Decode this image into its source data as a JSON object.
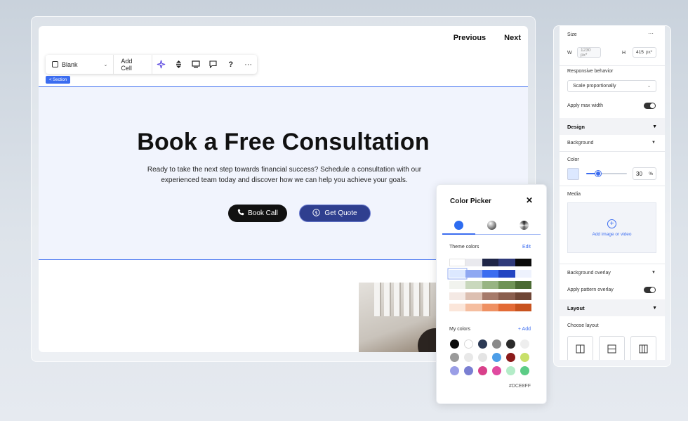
{
  "nav": {
    "previous": "Previous",
    "next": "Next"
  },
  "toolbar": {
    "blank_label": "Blank",
    "add_cell_label": "Add Cell"
  },
  "section_tag": "< Section",
  "hero": {
    "title": "Book a Free Consultation",
    "subtitle": "Ready to take the next step towards financial success? Schedule a consultation with our experienced team today and discover how we can help you achieve your goals.",
    "book_call": "Book Call",
    "get_quote": "Get Quote"
  },
  "color_picker": {
    "title": "Color Picker",
    "close": "✕",
    "theme_label": "Theme colors",
    "edit_label": "Edit",
    "my_colors_label": "My colors",
    "add_label": "+ Add",
    "hex_value": "#DCE8FF",
    "theme_rows": [
      [
        "#ffffff",
        "#e9e9ee",
        "#1e2547",
        "#2f3a7a",
        "#0a0a0a"
      ],
      [
        "#dce8ff",
        "#8fa8f2",
        "#3b6cf0",
        "#2244c2",
        "#eef2fd"
      ],
      [
        "#f1f3ee",
        "#c9d8bd",
        "#98b483",
        "#6f9356",
        "#4a6a33"
      ],
      [
        "#f4e9e4",
        "#dcbfb1",
        "#a67a6a",
        "#8a5e4e",
        "#6e4535"
      ],
      [
        "#fbe6da",
        "#f5bea0",
        "#ef9163",
        "#e36b36",
        "#c8531f"
      ]
    ],
    "my_colors": [
      "#0a0a0a",
      "#ffffff",
      "#2c3a55",
      "#8a8a8a",
      "#2b2b2b",
      "#eeeeee",
      "#9a9a9a",
      "#e8e8e8",
      "#e4e4e4",
      "#4d9ee8",
      "#8b1a1a",
      "#c8e06a",
      "#9a9ee6",
      "#7a7fd2",
      "#d8408a",
      "#e04aa0",
      "#b4ecc8",
      "#5ccc86"
    ]
  },
  "inspector": {
    "size_label": "Size",
    "w_label": "W",
    "w_value": "1230 px*",
    "h_label": "H",
    "h_value": "415",
    "h_unit": "px*",
    "more": "···",
    "responsive_label": "Responsive behavior",
    "responsive_value": "Scale proportionally",
    "max_width_label": "Apply max width",
    "design_label": "Design",
    "background_label": "Background",
    "color_label": "Color",
    "color_swatch": "#dce8ff",
    "opacity_value": "30",
    "opacity_fraction": 0.3,
    "opacity_unit": "%",
    "media_label": "Media",
    "media_add": "Add image or video",
    "bg_overlay_label": "Background overlay",
    "pattern_label": "Apply pattern overlay",
    "layout_label": "Layout",
    "choose_layout_label": "Choose layout"
  },
  "colors": {
    "accent": "#3b6cf0",
    "section_bg": "#f1f4fd",
    "quote_button": "#2f3f8f"
  }
}
